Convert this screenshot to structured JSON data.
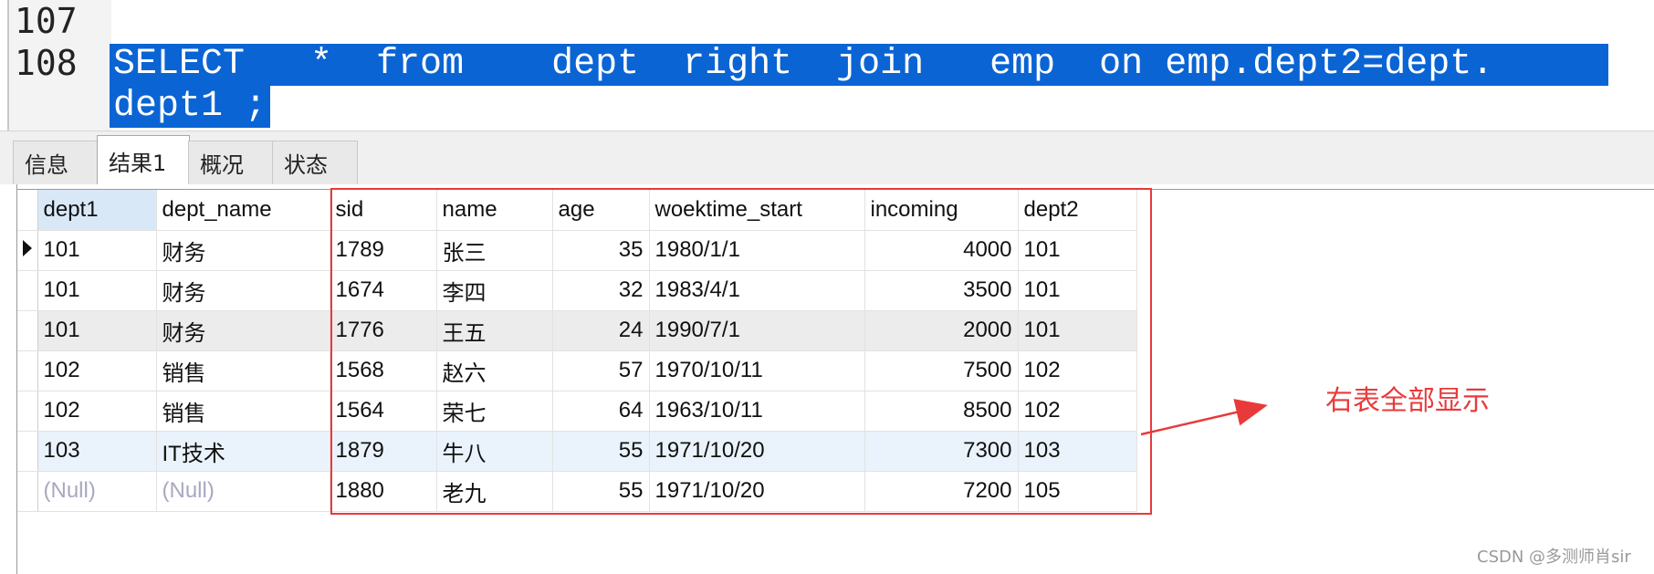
{
  "editor": {
    "line_numbers": [
      "107",
      "108"
    ],
    "selected_line1": "SELECT   *  from    dept  right  join   emp  on emp.dept2=dept.",
    "selected_line2": "dept1 ;"
  },
  "tabs": [
    {
      "label": "信息",
      "active": false
    },
    {
      "label": "结果1",
      "active": true
    },
    {
      "label": "概况",
      "active": false
    },
    {
      "label": "状态",
      "active": false
    }
  ],
  "grid": {
    "columns": [
      "dept1",
      "dept_name",
      "sid",
      "name",
      "age",
      "woektime_start",
      "incoming",
      "dept2"
    ],
    "rows": [
      [
        "101",
        "财务",
        "1789",
        "张三",
        "35",
        "1980/1/1",
        "4000",
        "101"
      ],
      [
        "101",
        "财务",
        "1674",
        "李四",
        "32",
        "1983/4/1",
        "3500",
        "101"
      ],
      [
        "101",
        "财务",
        "1776",
        "王五",
        "24",
        "1990/7/1",
        "2000",
        "101"
      ],
      [
        "102",
        "销售",
        "1568",
        "赵六",
        "57",
        "1970/10/11",
        "7500",
        "102"
      ],
      [
        "102",
        "销售",
        "1564",
        "荣七",
        "64",
        "1963/10/11",
        "8500",
        "102"
      ],
      [
        "103",
        "IT技术",
        "1879",
        "牛八",
        "55",
        "1971/10/20",
        "7300",
        "103"
      ],
      [
        "(Null)",
        "(Null)",
        "1880",
        "老九",
        "55",
        "1971/10/20",
        "7200",
        "105"
      ]
    ]
  },
  "annotation": {
    "text": "右表全部显示",
    "color": "#e83a3a"
  },
  "watermark": "CSDN @多测师肖sir",
  "colors": {
    "selection": "#0a64d4",
    "annotation": "#e83a3a"
  }
}
